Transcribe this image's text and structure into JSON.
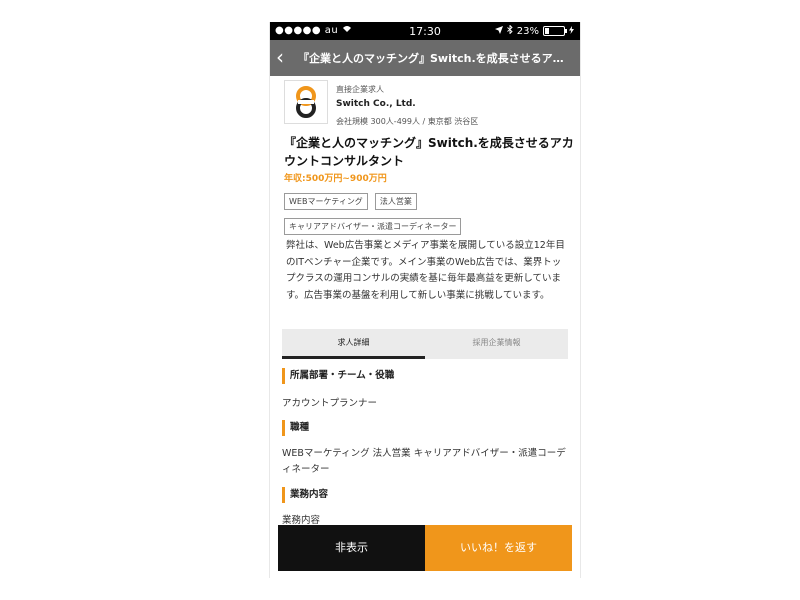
{
  "status_bar": {
    "carrier": "●●●●● au",
    "time": "17:30",
    "battery_percent": "23%",
    "battery_level": 0.23,
    "wifi_icon": "wifi-icon",
    "location_icon": "location-arrow-icon",
    "bluetooth_icon": "bluetooth-icon"
  },
  "nav": {
    "back_glyph": "‹",
    "title": "『企業と人のマッチング』Switch.を成長させるアカ..."
  },
  "company": {
    "kind": "直接企業求人",
    "name": "Switch Co., Ltd.",
    "meta": "会社規模 300人-499人 / 東京都 渋谷区",
    "logo_colors": {
      "dark": "#222222",
      "accent": "#f0961b"
    }
  },
  "job": {
    "title": "『企業と人のマッチング』Switch.を成長させるアカウントコンサルタント",
    "salary": "年収:500万円~900万円",
    "tags": [
      "WEBマーケティング",
      "法人営業",
      "キャリアアドバイザー・派遣コーディネーター"
    ],
    "description": "弊社は、Web広告事業とメディア事業を展開している設立12年目のITベンチャー企業です。メイン事業のWeb広告では、業界トップクラスの運用コンサルの実績を基に毎年最高益を更新しています。広告事業の基盤を利用して新しい事業に挑戦しています。"
  },
  "tabs": [
    {
      "label": "求人詳細",
      "active": true
    },
    {
      "label": "採用企業情報",
      "active": false
    }
  ],
  "sections": [
    {
      "heading": "所属部署・チーム・役職",
      "body": "アカウントプランナー"
    },
    {
      "heading": "職種",
      "body": "WEBマーケティング 法人営業 キャリアアドバイザー・派遣コーディネーター"
    },
    {
      "heading": "業務内容",
      "body": "業務内容"
    }
  ],
  "actions": {
    "hide_label": "非表示",
    "like_label": "いいね！を返す"
  },
  "colors": {
    "accent": "#f0961b",
    "nav_bg": "#6b6b6b",
    "hide_bg": "#111111"
  }
}
